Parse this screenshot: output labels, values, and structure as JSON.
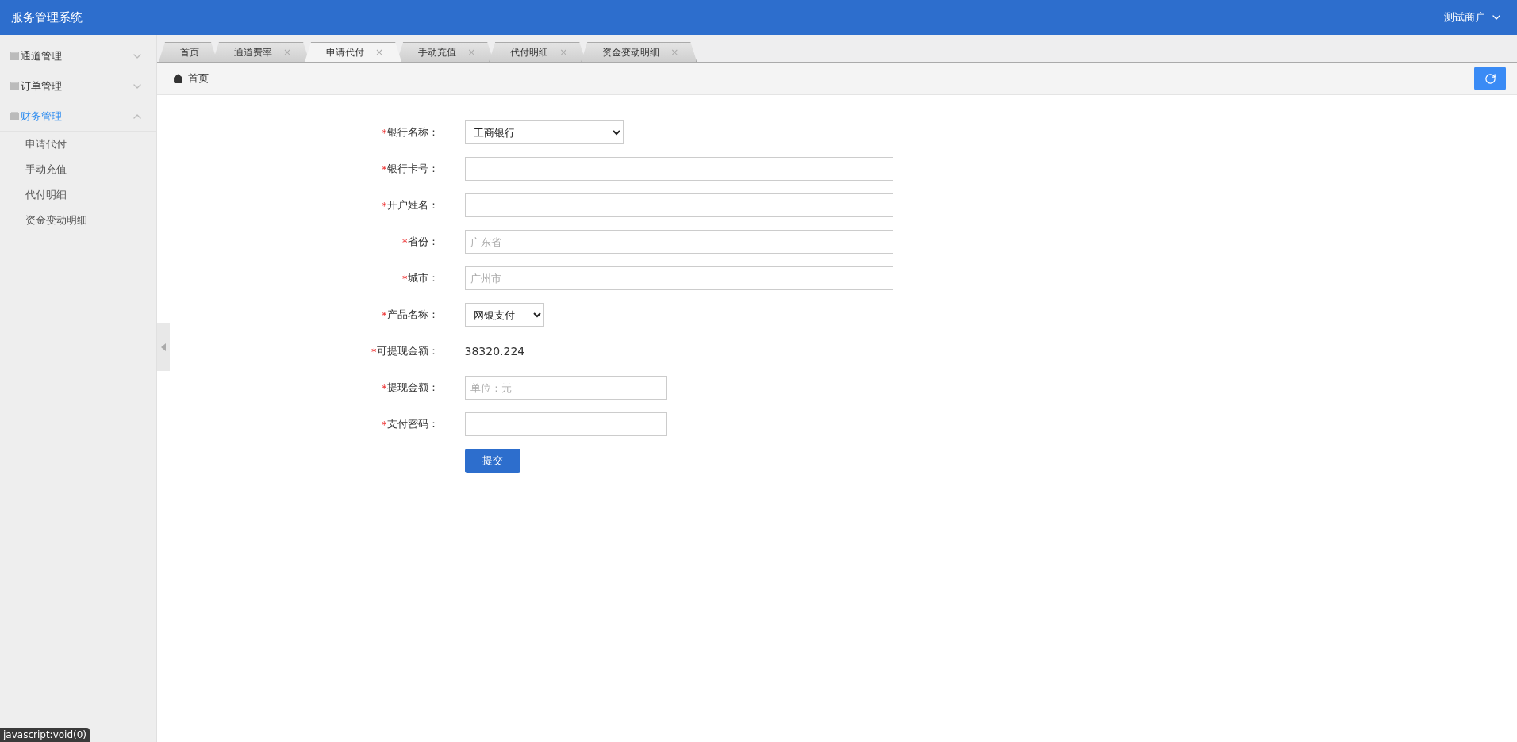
{
  "header": {
    "title": "服务管理系统",
    "user": "测试商户"
  },
  "sidebar": {
    "groups": [
      {
        "label": "通道管理",
        "expanded": false,
        "selected": false
      },
      {
        "label": "订单管理",
        "expanded": false,
        "selected": false
      },
      {
        "label": "财务管理",
        "expanded": true,
        "selected": true,
        "children": [
          {
            "label": "申请代付"
          },
          {
            "label": "手动充值"
          },
          {
            "label": "代付明细"
          },
          {
            "label": "资金变动明细"
          }
        ]
      }
    ]
  },
  "tabs": [
    {
      "label": "首页",
      "selected": false
    },
    {
      "label": "通道费率",
      "close": "×",
      "selected": false
    },
    {
      "label": "申请代付",
      "close": "×",
      "selected": true
    },
    {
      "label": "手动充值",
      "close": "×",
      "selected": false
    },
    {
      "label": "代付明细",
      "close": "×",
      "selected": false
    },
    {
      "label": "资金变动明细",
      "close": "×",
      "selected": false
    }
  ],
  "breadcrumb": "首页",
  "form": {
    "fields": [
      {
        "kind": "select",
        "mark": "*",
        "label": "银行名称：",
        "value": "工商银行"
      },
      {
        "kind": "text",
        "mark": "*",
        "label": "银行卡号："
      },
      {
        "kind": "text",
        "mark": "*",
        "label": "开户姓名："
      },
      {
        "kind": "text",
        "mark": "*",
        "label": "省份：",
        "placeholder": "广东省"
      },
      {
        "kind": "text",
        "mark": "*",
        "label": "城市：",
        "placeholder": "广州市"
      },
      {
        "kind": "select",
        "mark": "*",
        "label": "产品名称：",
        "value": "网银支付"
      },
      {
        "kind": "static",
        "mark": "*",
        "label": "可提现金额：",
        "value": "38320.224"
      },
      {
        "kind": "amount",
        "mark": "*",
        "label": "提现金额：",
        "placeholder": "单位：元"
      },
      {
        "kind": "password",
        "mark": "*",
        "label": "支付密码："
      }
    ],
    "submit": "提交"
  },
  "status_tip": "javascript:void(0)"
}
